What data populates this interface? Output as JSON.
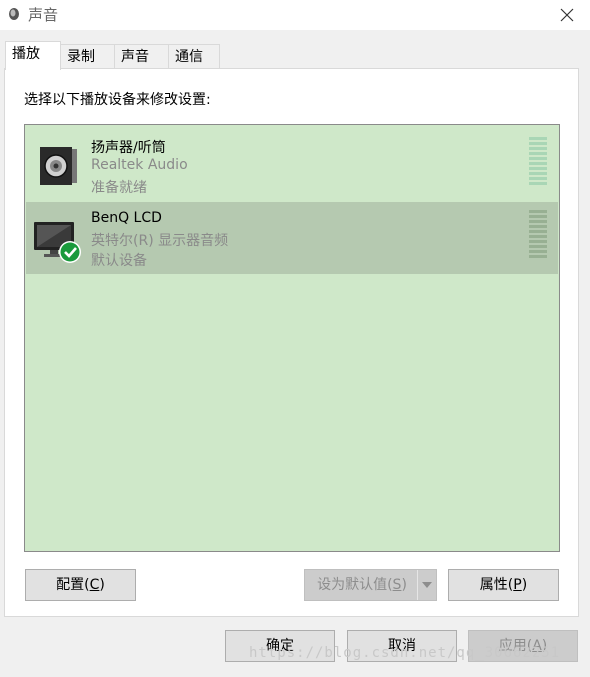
{
  "window": {
    "title": "声音"
  },
  "tabs": [
    {
      "label": "播放",
      "active": true
    },
    {
      "label": "录制",
      "active": false
    },
    {
      "label": "声音",
      "active": false
    },
    {
      "label": "通信",
      "active": false
    }
  ],
  "panel": {
    "instruction": "选择以下播放设备来修改设置:",
    "devices": [
      {
        "name": "扬声器/听筒",
        "description": "Realtek Audio",
        "status": "准备就绪",
        "icon": "speaker-icon",
        "selected": false,
        "default": false
      },
      {
        "name": "BenQ LCD",
        "description": "英特尔(R) 显示器音频",
        "status": "默认设备",
        "icon": "monitor-icon",
        "selected": true,
        "default": true
      }
    ],
    "configure_prefix": "配置(",
    "configure_key": "C",
    "configure_suffix": ")",
    "set_default_prefix": "设为默认值(",
    "set_default_key": "S",
    "set_default_suffix": ")",
    "properties_prefix": "属性(",
    "properties_key": "P",
    "properties_suffix": ")"
  },
  "footer": {
    "ok": "确定",
    "cancel": "取消",
    "apply_prefix": "应用(",
    "apply_key": "A",
    "apply_suffix": ")"
  },
  "watermark": "https://blog.csdn.net/qq_30662251",
  "colors": {
    "list_bg": "#cfe8c9",
    "selected_row": "#b5c9b0",
    "check_green": "#1a9a3c",
    "meter_bar": "#a9d6b5"
  }
}
